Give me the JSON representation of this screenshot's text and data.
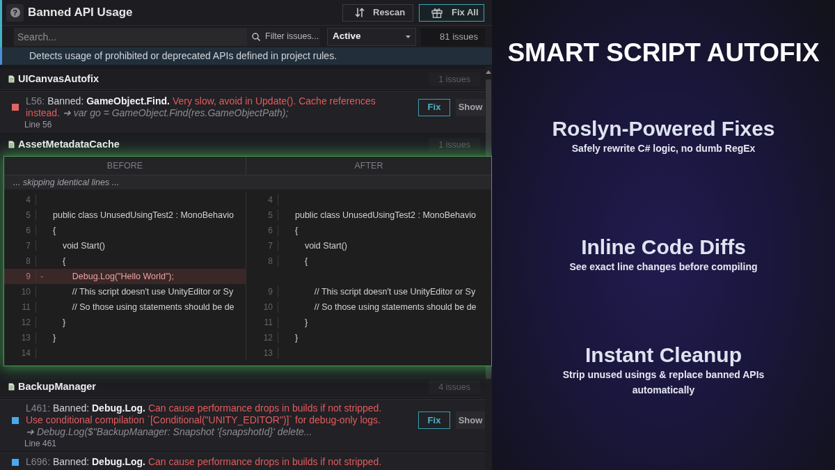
{
  "header": {
    "help_button": {
      "label": "?"
    },
    "title": "Banned API Usage",
    "actions": [
      {
        "label": "Rescan",
        "kind": "rescan"
      },
      {
        "label": "Fix All",
        "kind": "fix_all"
      }
    ]
  },
  "toolbar": {
    "search": {
      "placeholder": "Search..."
    },
    "filter_button": "Filter issues...",
    "status_dropdown": {
      "value": "Active"
    },
    "issue_count": "81 issues"
  },
  "description": "Detects usage of prohibited or deprecated APIs defined in project rules.",
  "groups": [
    {
      "file": "UICanvasAutofix",
      "count": "1 issues",
      "issues": [
        {
          "color": "#e06464",
          "line_ref": "L56:",
          "label": "Banned:",
          "api": "GameObject.Find.",
          "message": "Very slow, avoid in Update(). Cache references instead.",
          "suggestion": "➜ var go = GameObject.Find(res.GameObjectPath);",
          "line": "Line 56",
          "actions": [
            {
              "label": "Fix",
              "kind": "fix"
            },
            {
              "label": "Show",
              "kind": "show"
            }
          ]
        }
      ]
    },
    {
      "file": "AssetMetadataCache",
      "count": "1 issues"
    },
    {
      "file": "BackupManager",
      "count": "4 issues",
      "issues": [
        {
          "color": "#4aa8ec",
          "line_ref": "L461:",
          "label": "Banned:",
          "api": "Debug.Log.",
          "message": "Can cause performance drops in builds if not stripped. Use conditional compilation `[Conditional(\"UNITY_EDITOR\")]` for debug-only logs.",
          "suggestion": "➜ Debug.Log($\"BackupManager: Snapshot '{snapshotId}' delete...",
          "line": "Line 461",
          "actions": [
            {
              "label": "Fix",
              "kind": "fix"
            },
            {
              "label": "Show",
              "kind": "show"
            }
          ]
        },
        {
          "color": "#4aa8ec",
          "line_ref": "L696:",
          "label": "Banned:",
          "api": "Debug.Log.",
          "message": "Can cause performance drops in builds if not stripped."
        }
      ]
    }
  ],
  "diff_popup": {
    "columns": [
      "BEFORE",
      "AFTER"
    ],
    "note": "... skipping identical lines ...",
    "before": [
      {
        "kind": "context",
        "number": "4"
      },
      {
        "kind": "context",
        "number": "5",
        "code": "public class UnusedUsingTest2 : MonoBehavio"
      },
      {
        "kind": "context",
        "number": "6",
        "code": "{"
      },
      {
        "kind": "context",
        "number": "7",
        "code": "    void Start()"
      },
      {
        "kind": "context",
        "number": "8",
        "code": "    {"
      },
      {
        "kind": "removed",
        "number": "9",
        "marker": "-",
        "code": "        Debug.Log(\"Hello World\");"
      },
      {
        "kind": "context",
        "number": "10",
        "code": "        // This script doesn't use UnityEditor or Sy"
      },
      {
        "kind": "context",
        "number": "11",
        "code": "        // So those using statements should be de"
      },
      {
        "kind": "context",
        "number": "12",
        "code": "    }"
      },
      {
        "kind": "context",
        "number": "13",
        "code": "}"
      },
      {
        "kind": "context",
        "number": "14"
      }
    ],
    "after": [
      {
        "kind": "context",
        "number": "4"
      },
      {
        "kind": "context",
        "number": "5",
        "code": "public class UnusedUsingTest2 : MonoBehavio"
      },
      {
        "kind": "context",
        "number": "6",
        "code": "{"
      },
      {
        "kind": "context",
        "number": "7",
        "code": "    void Start()"
      },
      {
        "kind": "context",
        "number": "8",
        "code": "    {"
      },
      {
        "kind": "spacer"
      },
      {
        "kind": "context",
        "number": "9",
        "code": "        // This script doesn't use UnityEditor or Sy"
      },
      {
        "kind": "context",
        "number": "10",
        "code": "        // So those using statements should be de"
      },
      {
        "kind": "context",
        "number": "11",
        "code": "    }"
      },
      {
        "kind": "context",
        "number": "12",
        "code": "}"
      },
      {
        "kind": "context",
        "number": "13"
      }
    ]
  },
  "promo": {
    "headline": "SMART SCRIPT AUTOFIX",
    "features": [
      {
        "title": "Roslyn-Powered Fixes",
        "subtitle": "Safely rewrite C# logic, no dumb RegEx"
      },
      {
        "title": "Inline Code Diffs",
        "subtitle": "See exact line changes before compiling"
      },
      {
        "title": "Instant Cleanup",
        "subtitle": "Strip unused usings & replace banned APIs automatically"
      }
    ]
  }
}
